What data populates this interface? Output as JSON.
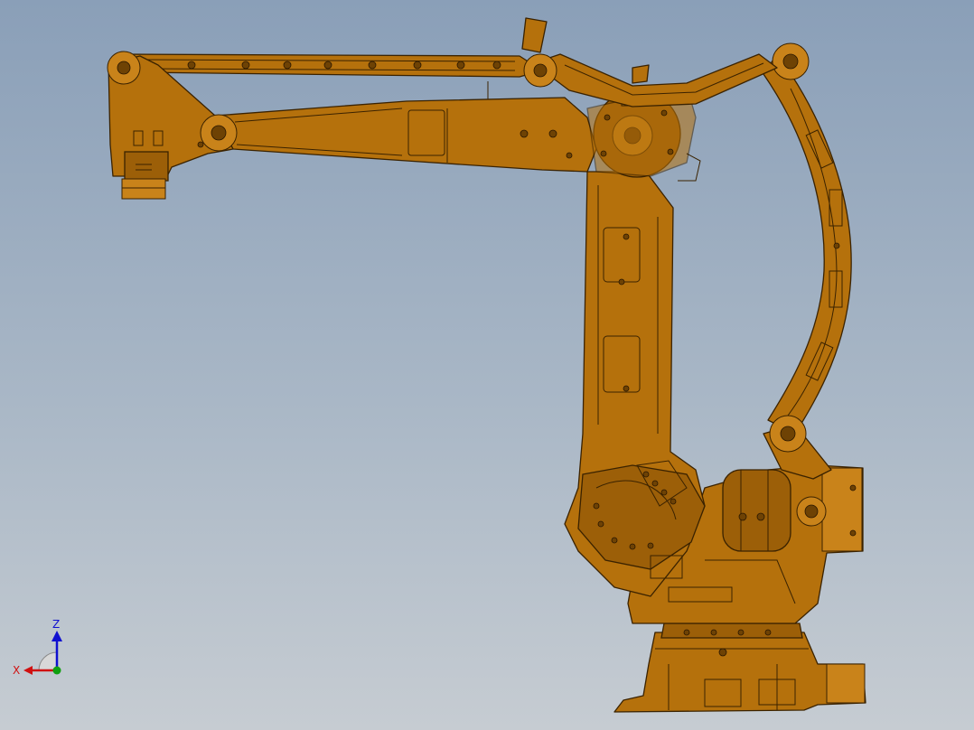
{
  "view": {
    "subject": "",
    "colors": {
      "background_top": "#8a9fb8",
      "background_bottom": "#c6ccd2",
      "part_fill": "#b5710c",
      "outline": "#3a2200",
      "x_axis": "#d01010",
      "y_axis": "#10a010",
      "z_axis": "#1010d0"
    }
  },
  "triad": {
    "z_label": "Z",
    "x_label": "X",
    "icons": [
      "x-axis-arrow-icon",
      "z-axis-arrow-icon",
      "y-axis-dot-icon"
    ]
  }
}
